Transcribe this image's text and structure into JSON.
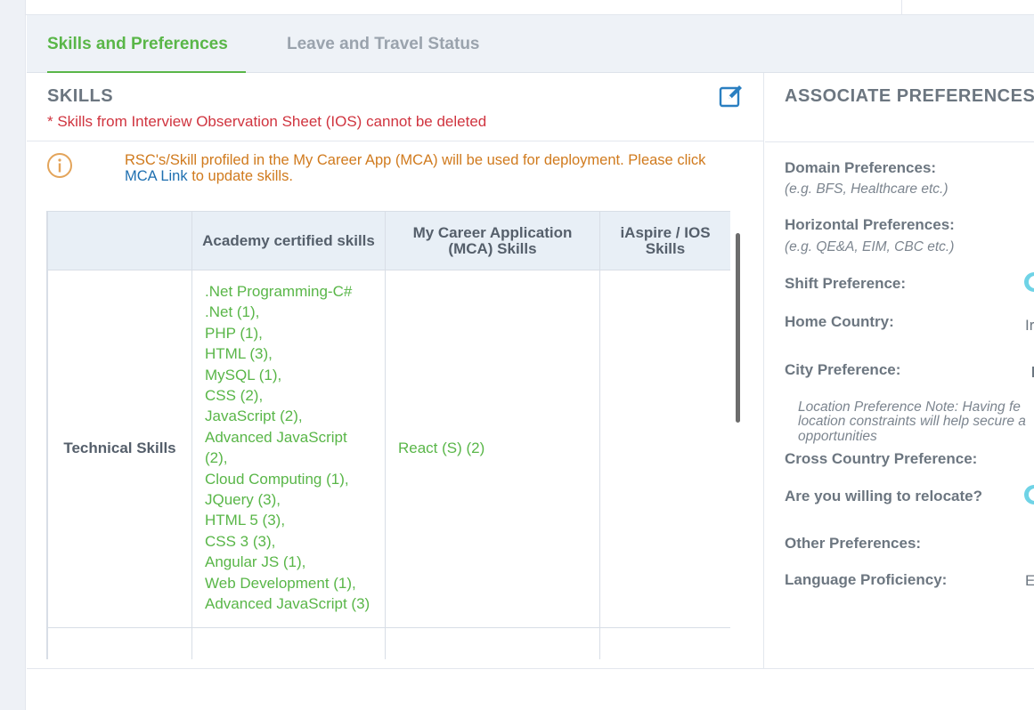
{
  "tabs": {
    "active_label": "Skills and Preferences",
    "inactive_label": "Leave and Travel Status"
  },
  "skills": {
    "title": "SKILLS",
    "note": "* Skills from Interview Observation Sheet (IOS) cannot be deleted",
    "edit_icon": "edit-icon",
    "info_icon": "info-icon",
    "info_before": "RSC's/Skill profiled in the My Career App (MCA) will be used for deployment. Please click ",
    "info_link": "MCA Link",
    "info_after": " to update skills.",
    "table": {
      "headers": [
        "",
        "Academy certified skills",
        "My Career Application (MCA) Skills",
        "iAspire / IOS Skills"
      ],
      "rows": [
        {
          "label": "Technical Skills",
          "academy_skills": [
            ".Net Programming-C#",
            ".Net (1),",
            "PHP (1),",
            "HTML (3),",
            "MySQL (1),",
            "CSS (2),",
            "JavaScript (2),",
            "Advanced JavaScript (2),",
            "Cloud Computing (1),",
            "JQuery (3),",
            "HTML 5 (3),",
            "CSS 3 (3),",
            "Angular JS (1),",
            "Web Development (1),",
            "Advanced JavaScript (3)"
          ],
          "mca_skills": "React (S) (2)",
          "ios_skills": ""
        }
      ]
    }
  },
  "preferences": {
    "title": "ASSOCIATE PREFERENCES",
    "domain_label": "Domain Preferences:",
    "domain_hint": "(e.g. BFS, Healthcare etc.)",
    "horizontal_label": "Horizontal Preferences:",
    "horizontal_hint": "(e.g. QE&A, EIM, CBC etc.)",
    "shift_label": "Shift Preference:",
    "home_country_label": "Home Country:",
    "home_country_value": "Ir",
    "city_label": "City Preference:",
    "location_note_1": "Location Preference Note: Having fe",
    "location_note_2": "location constraints will help secure a",
    "location_note_3": "opportunities",
    "cross_country_label": "Cross Country Preference:",
    "relocate_label": "Are you willing to relocate?",
    "other_label": "Other Preferences:",
    "language_label": "Language Proficiency:",
    "language_value": "E",
    "toggle_color": "#6fd3e6"
  },
  "colors": {
    "accent_green": "#59b648",
    "warning_red": "#d0343f",
    "info_orange": "#d07a1d",
    "link_blue": "#1e6fb0"
  }
}
